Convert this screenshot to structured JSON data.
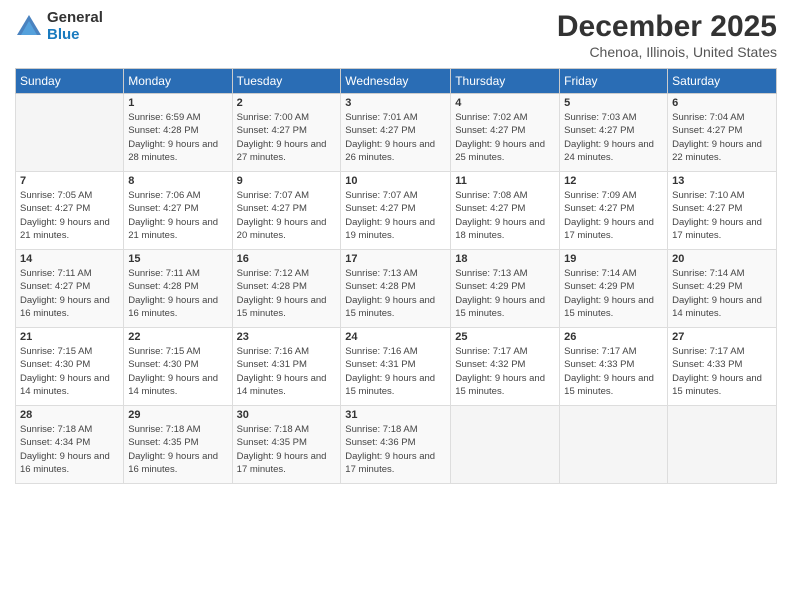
{
  "logo": {
    "general": "General",
    "blue": "Blue"
  },
  "title": "December 2025",
  "location": "Chenoa, Illinois, United States",
  "days_of_week": [
    "Sunday",
    "Monday",
    "Tuesday",
    "Wednesday",
    "Thursday",
    "Friday",
    "Saturday"
  ],
  "weeks": [
    [
      {
        "num": "",
        "sunrise": "",
        "sunset": "",
        "daylight": ""
      },
      {
        "num": "1",
        "sunrise": "Sunrise: 6:59 AM",
        "sunset": "Sunset: 4:28 PM",
        "daylight": "Daylight: 9 hours and 28 minutes."
      },
      {
        "num": "2",
        "sunrise": "Sunrise: 7:00 AM",
        "sunset": "Sunset: 4:27 PM",
        "daylight": "Daylight: 9 hours and 27 minutes."
      },
      {
        "num": "3",
        "sunrise": "Sunrise: 7:01 AM",
        "sunset": "Sunset: 4:27 PM",
        "daylight": "Daylight: 9 hours and 26 minutes."
      },
      {
        "num": "4",
        "sunrise": "Sunrise: 7:02 AM",
        "sunset": "Sunset: 4:27 PM",
        "daylight": "Daylight: 9 hours and 25 minutes."
      },
      {
        "num": "5",
        "sunrise": "Sunrise: 7:03 AM",
        "sunset": "Sunset: 4:27 PM",
        "daylight": "Daylight: 9 hours and 24 minutes."
      },
      {
        "num": "6",
        "sunrise": "Sunrise: 7:04 AM",
        "sunset": "Sunset: 4:27 PM",
        "daylight": "Daylight: 9 hours and 22 minutes."
      }
    ],
    [
      {
        "num": "7",
        "sunrise": "Sunrise: 7:05 AM",
        "sunset": "Sunset: 4:27 PM",
        "daylight": "Daylight: 9 hours and 21 minutes."
      },
      {
        "num": "8",
        "sunrise": "Sunrise: 7:06 AM",
        "sunset": "Sunset: 4:27 PM",
        "daylight": "Daylight: 9 hours and 21 minutes."
      },
      {
        "num": "9",
        "sunrise": "Sunrise: 7:07 AM",
        "sunset": "Sunset: 4:27 PM",
        "daylight": "Daylight: 9 hours and 20 minutes."
      },
      {
        "num": "10",
        "sunrise": "Sunrise: 7:07 AM",
        "sunset": "Sunset: 4:27 PM",
        "daylight": "Daylight: 9 hours and 19 minutes."
      },
      {
        "num": "11",
        "sunrise": "Sunrise: 7:08 AM",
        "sunset": "Sunset: 4:27 PM",
        "daylight": "Daylight: 9 hours and 18 minutes."
      },
      {
        "num": "12",
        "sunrise": "Sunrise: 7:09 AM",
        "sunset": "Sunset: 4:27 PM",
        "daylight": "Daylight: 9 hours and 17 minutes."
      },
      {
        "num": "13",
        "sunrise": "Sunrise: 7:10 AM",
        "sunset": "Sunset: 4:27 PM",
        "daylight": "Daylight: 9 hours and 17 minutes."
      }
    ],
    [
      {
        "num": "14",
        "sunrise": "Sunrise: 7:11 AM",
        "sunset": "Sunset: 4:27 PM",
        "daylight": "Daylight: 9 hours and 16 minutes."
      },
      {
        "num": "15",
        "sunrise": "Sunrise: 7:11 AM",
        "sunset": "Sunset: 4:28 PM",
        "daylight": "Daylight: 9 hours and 16 minutes."
      },
      {
        "num": "16",
        "sunrise": "Sunrise: 7:12 AM",
        "sunset": "Sunset: 4:28 PM",
        "daylight": "Daylight: 9 hours and 15 minutes."
      },
      {
        "num": "17",
        "sunrise": "Sunrise: 7:13 AM",
        "sunset": "Sunset: 4:28 PM",
        "daylight": "Daylight: 9 hours and 15 minutes."
      },
      {
        "num": "18",
        "sunrise": "Sunrise: 7:13 AM",
        "sunset": "Sunset: 4:29 PM",
        "daylight": "Daylight: 9 hours and 15 minutes."
      },
      {
        "num": "19",
        "sunrise": "Sunrise: 7:14 AM",
        "sunset": "Sunset: 4:29 PM",
        "daylight": "Daylight: 9 hours and 15 minutes."
      },
      {
        "num": "20",
        "sunrise": "Sunrise: 7:14 AM",
        "sunset": "Sunset: 4:29 PM",
        "daylight": "Daylight: 9 hours and 14 minutes."
      }
    ],
    [
      {
        "num": "21",
        "sunrise": "Sunrise: 7:15 AM",
        "sunset": "Sunset: 4:30 PM",
        "daylight": "Daylight: 9 hours and 14 minutes."
      },
      {
        "num": "22",
        "sunrise": "Sunrise: 7:15 AM",
        "sunset": "Sunset: 4:30 PM",
        "daylight": "Daylight: 9 hours and 14 minutes."
      },
      {
        "num": "23",
        "sunrise": "Sunrise: 7:16 AM",
        "sunset": "Sunset: 4:31 PM",
        "daylight": "Daylight: 9 hours and 14 minutes."
      },
      {
        "num": "24",
        "sunrise": "Sunrise: 7:16 AM",
        "sunset": "Sunset: 4:31 PM",
        "daylight": "Daylight: 9 hours and 15 minutes."
      },
      {
        "num": "25",
        "sunrise": "Sunrise: 7:17 AM",
        "sunset": "Sunset: 4:32 PM",
        "daylight": "Daylight: 9 hours and 15 minutes."
      },
      {
        "num": "26",
        "sunrise": "Sunrise: 7:17 AM",
        "sunset": "Sunset: 4:33 PM",
        "daylight": "Daylight: 9 hours and 15 minutes."
      },
      {
        "num": "27",
        "sunrise": "Sunrise: 7:17 AM",
        "sunset": "Sunset: 4:33 PM",
        "daylight": "Daylight: 9 hours and 15 minutes."
      }
    ],
    [
      {
        "num": "28",
        "sunrise": "Sunrise: 7:18 AM",
        "sunset": "Sunset: 4:34 PM",
        "daylight": "Daylight: 9 hours and 16 minutes."
      },
      {
        "num": "29",
        "sunrise": "Sunrise: 7:18 AM",
        "sunset": "Sunset: 4:35 PM",
        "daylight": "Daylight: 9 hours and 16 minutes."
      },
      {
        "num": "30",
        "sunrise": "Sunrise: 7:18 AM",
        "sunset": "Sunset: 4:35 PM",
        "daylight": "Daylight: 9 hours and 17 minutes."
      },
      {
        "num": "31",
        "sunrise": "Sunrise: 7:18 AM",
        "sunset": "Sunset: 4:36 PM",
        "daylight": "Daylight: 9 hours and 17 minutes."
      },
      {
        "num": "",
        "sunrise": "",
        "sunset": "",
        "daylight": ""
      },
      {
        "num": "",
        "sunrise": "",
        "sunset": "",
        "daylight": ""
      },
      {
        "num": "",
        "sunrise": "",
        "sunset": "",
        "daylight": ""
      }
    ]
  ]
}
